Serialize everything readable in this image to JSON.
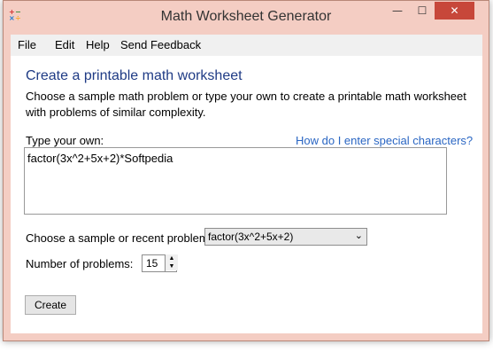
{
  "window": {
    "title": "Math Worksheet Generator",
    "controls": {
      "minimize": "—",
      "maximize": "☐",
      "close": "✕"
    }
  },
  "menu": [
    "File",
    "Edit",
    "Help",
    "Send Feedback"
  ],
  "main": {
    "heading": "Create a printable math worksheet",
    "description": "Choose a sample math problem or type your own to create a printable math worksheet with problems of similar complexity.",
    "type_label": "Type your own:",
    "help_link": "How do I enter special characters?",
    "problem_value": "factor(3x^2+5x+2)*Softpedia",
    "sample_label": "Choose a sample or recent problem:",
    "sample_selected": "factor(3x^2+5x+2)",
    "num_label": "Number of problems:",
    "num_value": "15",
    "create_label": "Create"
  },
  "colors": {
    "heading": "#1f3b85",
    "link": "#2a66c3",
    "frame": "#f4cdc3",
    "close_button": "#c7473a"
  },
  "icons": [
    "app-calculator-icon",
    "chevron-down-icon",
    "spin-up-icon",
    "spin-down-icon"
  ]
}
